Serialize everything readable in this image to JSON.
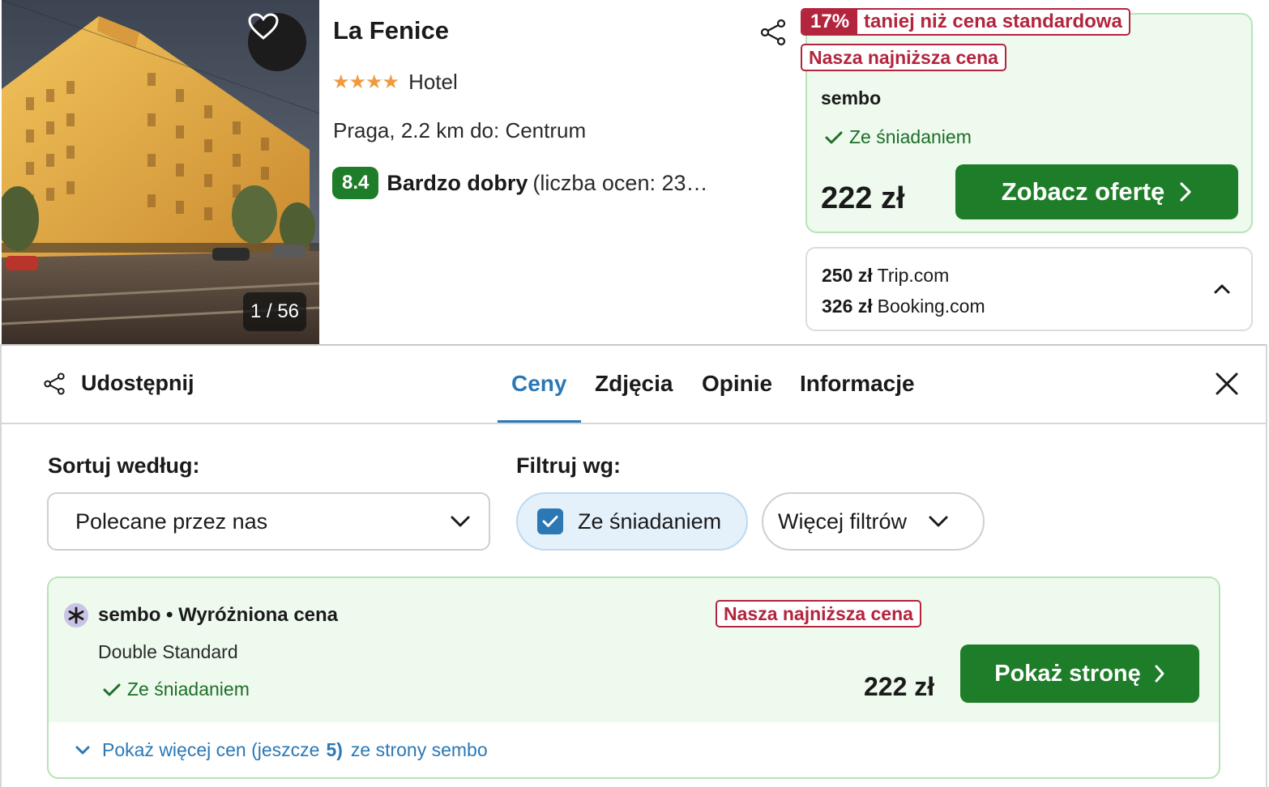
{
  "hotel": {
    "name": "La Fenice",
    "stars": "★★★★",
    "type": "Hotel",
    "location": "Praga, 2.2 km do: Centrum",
    "rating_score": "8.4",
    "rating_label": "Bardzo dobry",
    "rating_count": "(liczba ocen: 23…",
    "photo_counter": "1 / 56"
  },
  "best_offer": {
    "discount_pct": "17%",
    "discount_text": "taniej niż cena standardowa",
    "lowest_tag": "Nasza najniższa cena",
    "provider": "sembo",
    "breakfast": "Ze śniadaniem",
    "price": "222 zł",
    "button_label": "Zobacz ofertę"
  },
  "other_prices": [
    {
      "price": "250 zł",
      "provider": "Trip.com"
    },
    {
      "price": "326 zł",
      "provider": "Booking.com"
    }
  ],
  "tabs": {
    "share_label": "Udostępnij",
    "items": [
      "Ceny",
      "Zdjęcia",
      "Opinie",
      "Informacje"
    ],
    "active": "Ceny"
  },
  "sort": {
    "label": "Sortuj według:",
    "selected": "Polecane przez nas"
  },
  "filter": {
    "label": "Filtruj wg:",
    "breakfast_chip": "Ze śniadaniem",
    "more_filters": "Więcej filtrów"
  },
  "deal": {
    "title": "sembo • Wyróżniona cena",
    "lowest_tag": "Nasza najniższa cena",
    "room": "Double Standard",
    "breakfast": "Ze śniadaniem",
    "price": "222 zł",
    "button_label": "Pokaż stronę",
    "more_prefix": "Pokaż więcej cen (jeszcze",
    "more_count": "5)",
    "more_suffix": "ze strony sembo"
  },
  "colors": {
    "green": "#1e7d28",
    "blue": "#2b78b5",
    "red": "#b3243d",
    "offer_bg": "#eefaee",
    "star": "#f09a3e"
  }
}
